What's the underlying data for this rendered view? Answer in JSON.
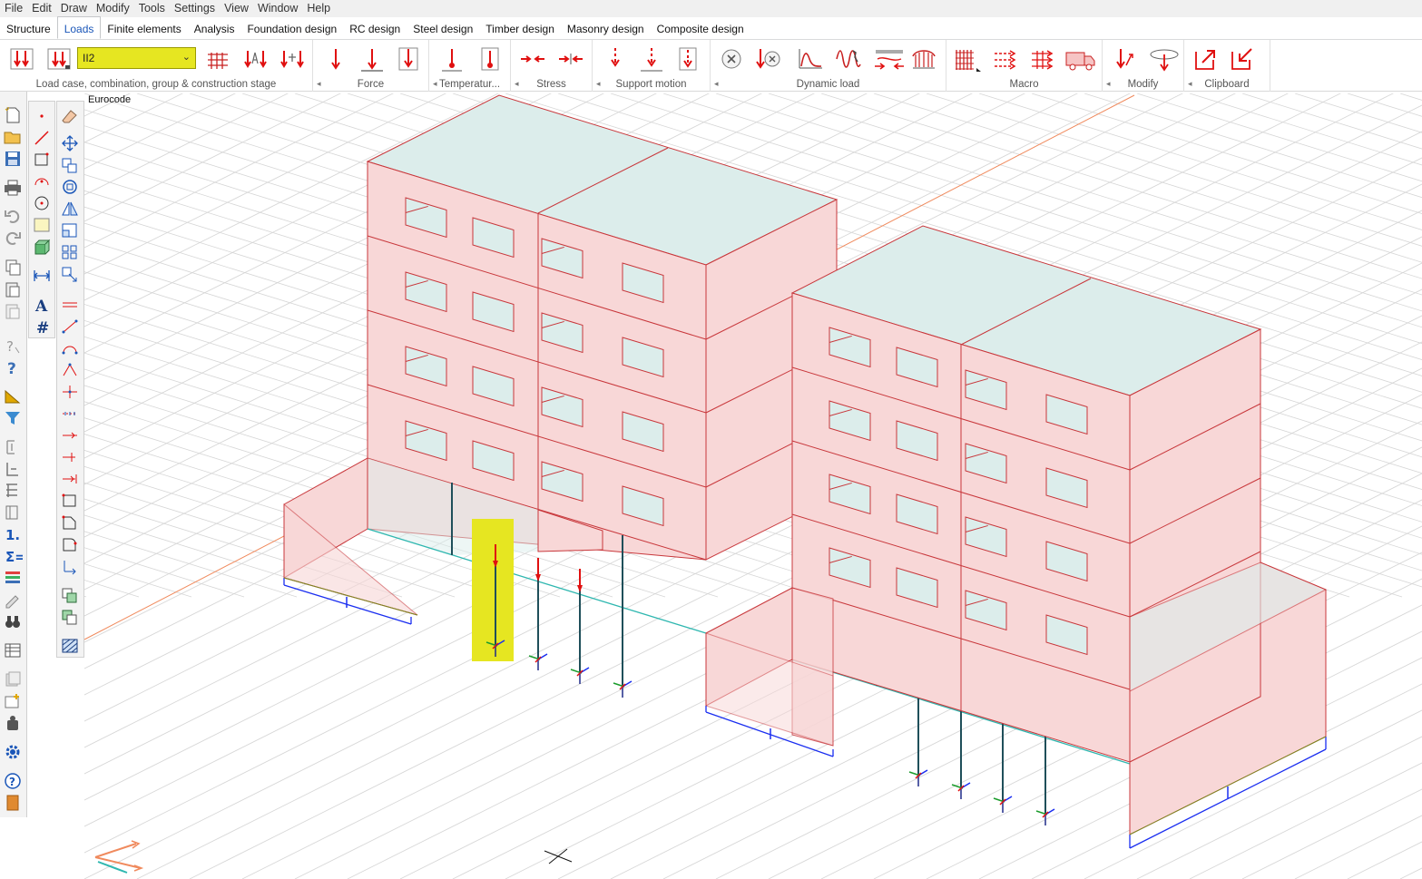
{
  "menu": [
    "File",
    "Edit",
    "Draw",
    "Modify",
    "Tools",
    "Settings",
    "View",
    "Window",
    "Help"
  ],
  "tabs": [
    {
      "label": "Structure",
      "active": false
    },
    {
      "label": "Loads",
      "active": true
    },
    {
      "label": "Finite elements",
      "active": false
    },
    {
      "label": "Analysis",
      "active": false
    },
    {
      "label": "Foundation design",
      "active": false
    },
    {
      "label": "RC design",
      "active": false
    },
    {
      "label": "Steel design",
      "active": false
    },
    {
      "label": "Timber design",
      "active": false
    },
    {
      "label": "Masonry design",
      "active": false
    },
    {
      "label": "Composite design",
      "active": false
    }
  ],
  "ribbon": {
    "load_case_value": "II2",
    "groups": {
      "load_case": "Load case, combination, group  & construction stage",
      "force": "Force",
      "temperature": "Temperatur...",
      "stress": "Stress",
      "support_motion": "Support motion",
      "dynamic_load": "Dynamic load",
      "macro": "Macro",
      "modify": "Modify",
      "clipboard": "Clipboard"
    }
  },
  "viewport": {
    "code_label": "Eurocode"
  },
  "colors": {
    "accent_tab": "#1a56b8",
    "highlight": "#e6e621",
    "wall_fill": "#f8d7d7",
    "wall_stroke": "#c8373b",
    "slab_fill": "#dcedeb",
    "load_arrow": "#e01010"
  }
}
